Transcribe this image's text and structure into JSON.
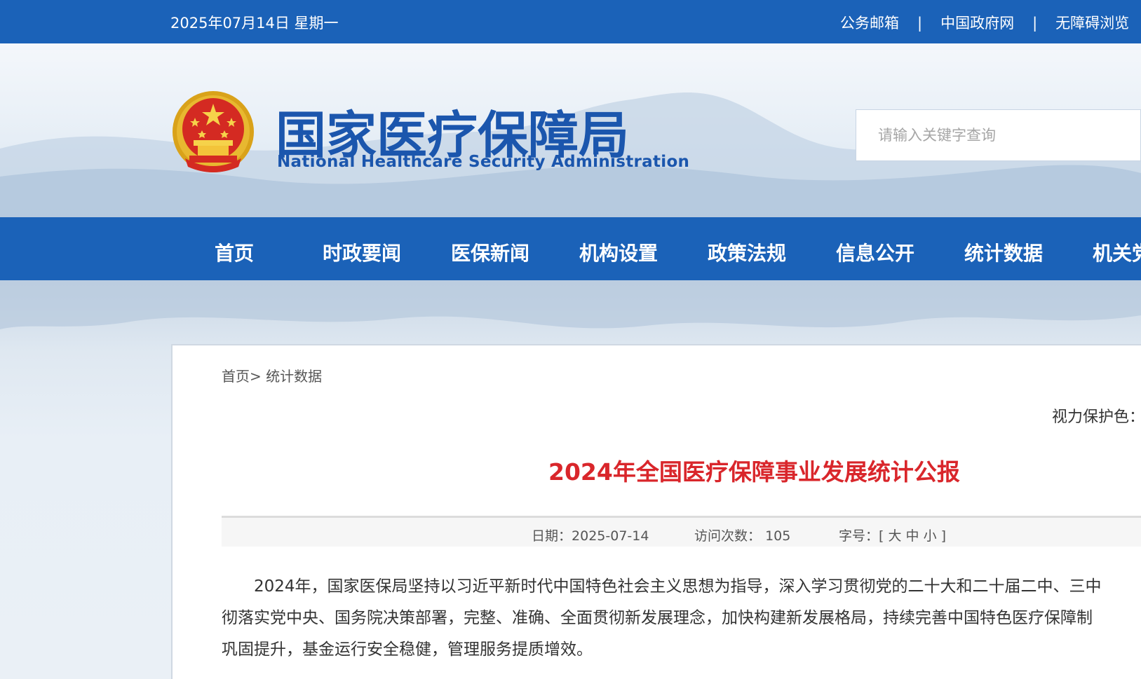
{
  "topbar": {
    "date": "2025年07月14日 星期一",
    "links": [
      "公务邮箱",
      "中国政府网",
      "无障碍浏览"
    ],
    "separator": "|"
  },
  "header": {
    "title": "国家医疗保障局",
    "subtitle": "National Healthcare Security Administration",
    "search_placeholder": "请输入关键字查询"
  },
  "nav": {
    "items": [
      "首页",
      "时政要闻",
      "医保新闻",
      "机构设置",
      "政策法规",
      "信息公开",
      "统计数据",
      "机关党建"
    ]
  },
  "breadcrumb": {
    "home": "首页",
    "separator": ">",
    "current": "统计数据"
  },
  "article": {
    "eye_protect_label": "视力保护色：",
    "title": "2024年全国医疗保障事业发展统计公报",
    "date_label": "日期：",
    "date": "2025-07-14",
    "visits_label": "访问次数：",
    "visits": "105",
    "font_size_label": "字号：",
    "font_size_options": [
      "大",
      "中",
      "小"
    ],
    "paragraph_lines": [
      "　　2024年，国家医保局坚持以习近平新时代中国特色社会主义思想为指导，深入学习贯彻党的二十大和二十届二中、三中",
      "彻落实党中央、国务院决策部署，完整、准确、全面贯彻新发展理念，加快构建新发展格局，持续完善中国特色医疗保障制",
      "巩固提升，基金运行安全稳健，管理服务提质增效。"
    ]
  },
  "colors": {
    "primary_blue": "#1b62b8",
    "title_blue": "#1b56ad",
    "headline_red": "#d9262b"
  }
}
